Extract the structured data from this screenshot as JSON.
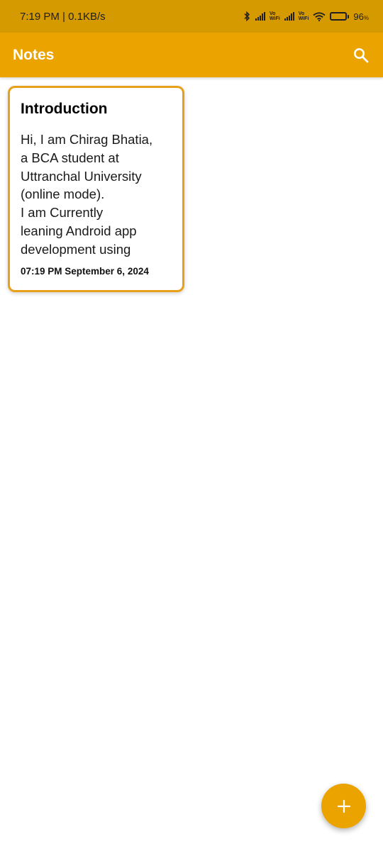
{
  "status_bar": {
    "time_speed": "7:19 PM | 0.1KB/s",
    "vowifi_1_top": "Vo",
    "vowifi_1_bottom": "WiFi",
    "vowifi_2_top": "Vo",
    "vowifi_2_bottom": "WiFi",
    "battery_level": "96",
    "battery_unit": "%",
    "icons": [
      "bluetooth-icon",
      "signal-icon",
      "signal-icon",
      "wifi-icon",
      "battery-icon"
    ]
  },
  "app_bar": {
    "title": "Notes",
    "search_icon": "search-icon"
  },
  "notes": [
    {
      "title": "Introduction",
      "body": "Hi, I am Chirag Bhatia,\na BCA student at\nUttranchal University\n(online mode).\nI am Currently\nleaning Android app\ndevelopment using",
      "date": "07:19 PM September 6, 2024"
    }
  ],
  "fab": {
    "icon": "plus-icon",
    "label": "+"
  },
  "colors": {
    "status_bar": "#d59a00",
    "app_bar": "#eba300",
    "card_border": "#e6a01a",
    "fab": "#eba300"
  }
}
